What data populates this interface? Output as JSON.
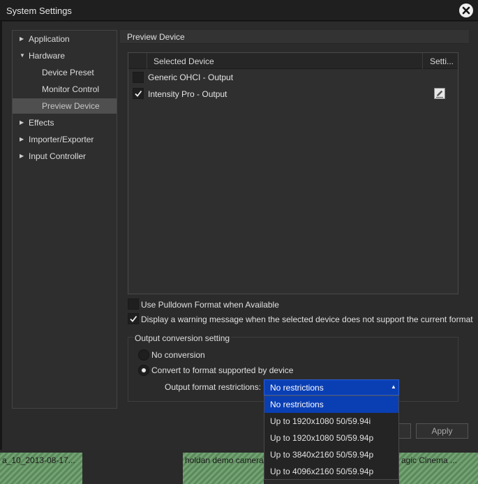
{
  "window": {
    "title": "System Settings",
    "close_icon": "close-icon"
  },
  "sidebar": {
    "items": [
      {
        "label": "Application",
        "expander": "▶"
      },
      {
        "label": "Hardware",
        "expander": "▼"
      },
      {
        "label": "Device Preset"
      },
      {
        "label": "Monitor Control"
      },
      {
        "label": "Preview Device",
        "selected": true
      },
      {
        "label": "Effects",
        "expander": "▶"
      },
      {
        "label": "Importer/Exporter",
        "expander": "▶"
      },
      {
        "label": "Input Controller",
        "expander": "▶"
      }
    ]
  },
  "panel": {
    "title": "Preview Device",
    "table": {
      "col_selected": "Selected Device",
      "col_settings": "Setti...",
      "rows": [
        {
          "name": "Generic OHCI - Output",
          "checked": false
        },
        {
          "name": "Intensity Pro - Output",
          "checked": true,
          "settings_icon": "edit-settings-icon"
        }
      ]
    },
    "pulldown_label": "Use Pulldown Format when Available",
    "pulldown_checked": false,
    "warning_label": "Display a warning message when the selected device does not support the current format",
    "warning_checked": true,
    "conversion": {
      "group_title": "Output conversion setting",
      "no_conversion": "No conversion",
      "convert": "Convert to format supported by device",
      "selected_option": "Convert to format supported by device",
      "restrictions_label": "Output format restrictions:",
      "selected_value": "No restrictions",
      "options": [
        "No restrictions",
        "Up to 1920x1080 50/59.94i",
        "Up to 1920x1080 50/59.94p",
        "Up to 3840x2160 50/59.94p",
        "Up to 4096x2160 50/59.94p"
      ]
    },
    "apply_label": "Apply"
  },
  "timeline": {
    "clips": [
      "a_10_2013-08-17...",
      "holdan demo camera",
      "agic Cinema ..."
    ]
  },
  "colors": {
    "accent": "#0a3fb4",
    "clip": "#5c8a5c"
  }
}
